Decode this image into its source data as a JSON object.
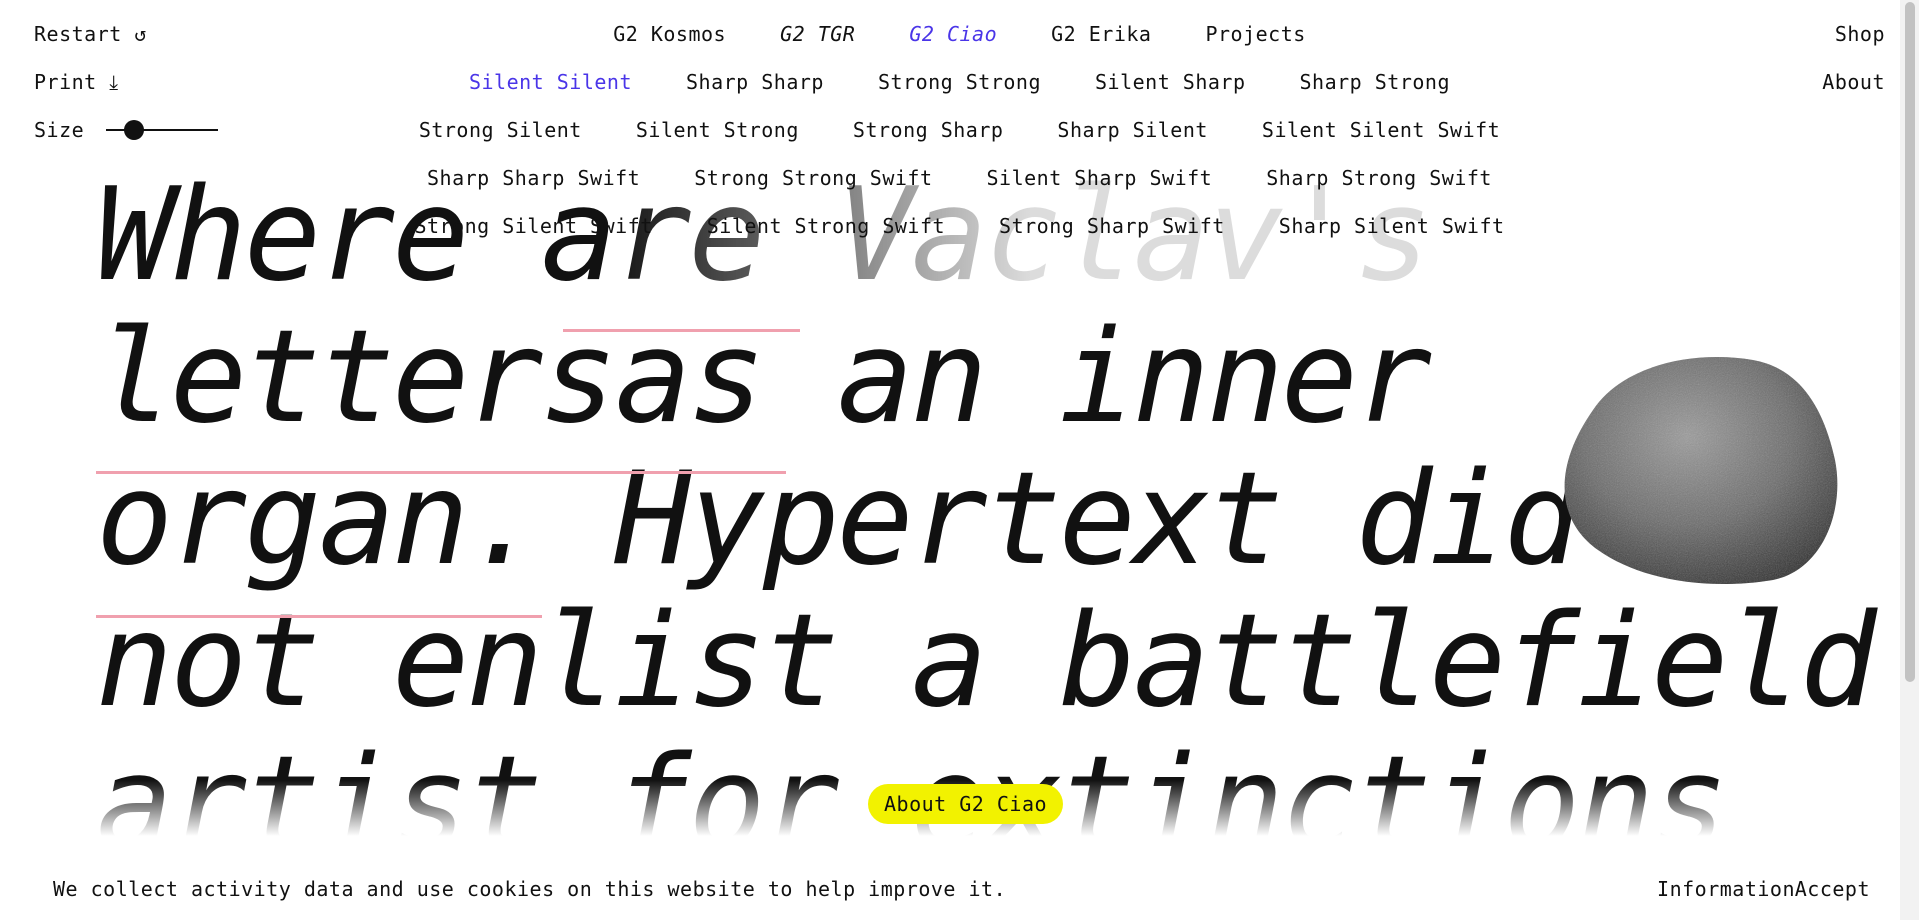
{
  "top_left": {
    "restart_label": "Restart ↺",
    "print_label": "Print ⤓",
    "size_label": "Size",
    "size_value": 0.25
  },
  "top_right": {
    "shop_label": "Shop",
    "about_label": "About"
  },
  "fonts_nav": [
    {
      "label": "G2 Kosmos",
      "italic": false,
      "active": false
    },
    {
      "label": "G2 TGR",
      "italic": true,
      "active": false
    },
    {
      "label": "G2 Ciao",
      "italic": true,
      "active": true
    },
    {
      "label": "G2 Erika",
      "italic": false,
      "active": false
    },
    {
      "label": "Projects",
      "italic": false,
      "active": false
    }
  ],
  "style_rows": [
    [
      "Silent Silent",
      "Sharp Sharp",
      "Strong Strong",
      "Silent Sharp",
      "Sharp Strong"
    ],
    [
      "Strong Silent",
      "Silent Strong",
      "Strong Sharp",
      "Sharp Silent",
      "Silent Silent Swift"
    ],
    [
      "Sharp Sharp Swift",
      "Strong Strong Swift",
      "Silent Sharp Swift",
      "Sharp Strong Swift"
    ],
    [
      "Strong Silent Swift",
      "Silent Strong Swift",
      "Strong Sharp Swift",
      "Sharp Silent Swift"
    ]
  ],
  "active_style": "Silent Silent",
  "colors": {
    "accent": "#4a35e8",
    "pill": "#f2f200",
    "underline": "#f0a0ae"
  },
  "hero_lines": [
    "Where are Vaclav's",
    "lettersas an inner",
    "organ. Hypertext did",
    "not enlist a battlefield",
    "artist for extinctions"
  ],
  "about_pill_label": "About G2 Ciao",
  "cookie": {
    "text": "We collect activity data and use cookies on this website to help improve it.",
    "info_label": "Information",
    "accept_label": "Accept"
  }
}
